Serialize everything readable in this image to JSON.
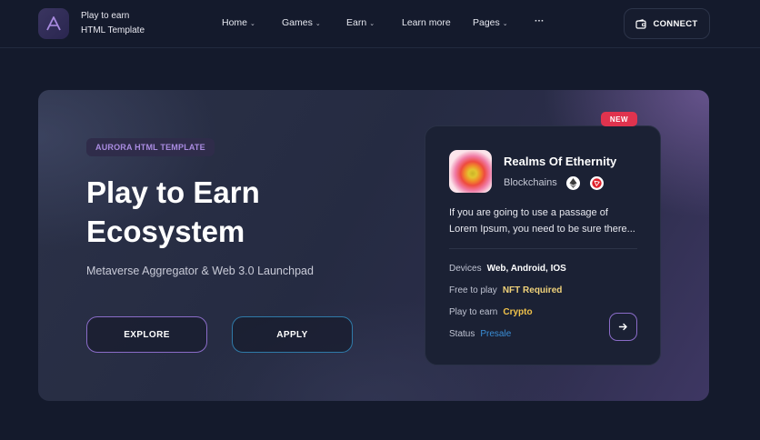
{
  "header": {
    "brand_line1": "Play to earn",
    "brand_line2": "HTML Template",
    "nav": [
      {
        "label": "Home",
        "dropdown": true
      },
      {
        "label": "Games",
        "dropdown": true
      },
      {
        "label": "Earn",
        "dropdown": true
      },
      {
        "label": "Learn more",
        "dropdown": false
      },
      {
        "label": "Pages",
        "dropdown": true
      },
      {
        "label": "···",
        "dropdown": false
      }
    ],
    "connect_label": "CONNECT"
  },
  "hero": {
    "tag": "AURORA HTML TEMPLATE",
    "title_line1": "Play to Earn",
    "title_line2": "Ecosystem",
    "subtitle": "Metaverse Aggregator & Web 3.0 Launchpad",
    "explore_label": "EXPLORE",
    "apply_label": "APPLY"
  },
  "card": {
    "badge": "NEW",
    "name": "Realms Of Ethernity",
    "chains_label": "Blockchains",
    "chain_icons": [
      "ethereum-icon",
      "tron-icon"
    ],
    "desc_line1": "If you are going to use a passage of",
    "desc_line2": "Lorem Ipsum, you need to be sure there...",
    "rows": [
      {
        "label": "Devices",
        "value": "Web, Android, IOS",
        "color": "#ffffff"
      },
      {
        "label": "Free to play",
        "value": "NFT Required",
        "color": "#f0d27a"
      },
      {
        "label": "Play to earn",
        "value": "Crypto",
        "color": "#f0c24a"
      },
      {
        "label": "Status",
        "value": "Presale",
        "color": "#3a8fd8"
      }
    ]
  },
  "colors": {
    "background": "#141a2c",
    "accent_purple": "#8a6cc8",
    "accent_blue": "#2f7aa8",
    "badge_red": "#e0334e"
  }
}
